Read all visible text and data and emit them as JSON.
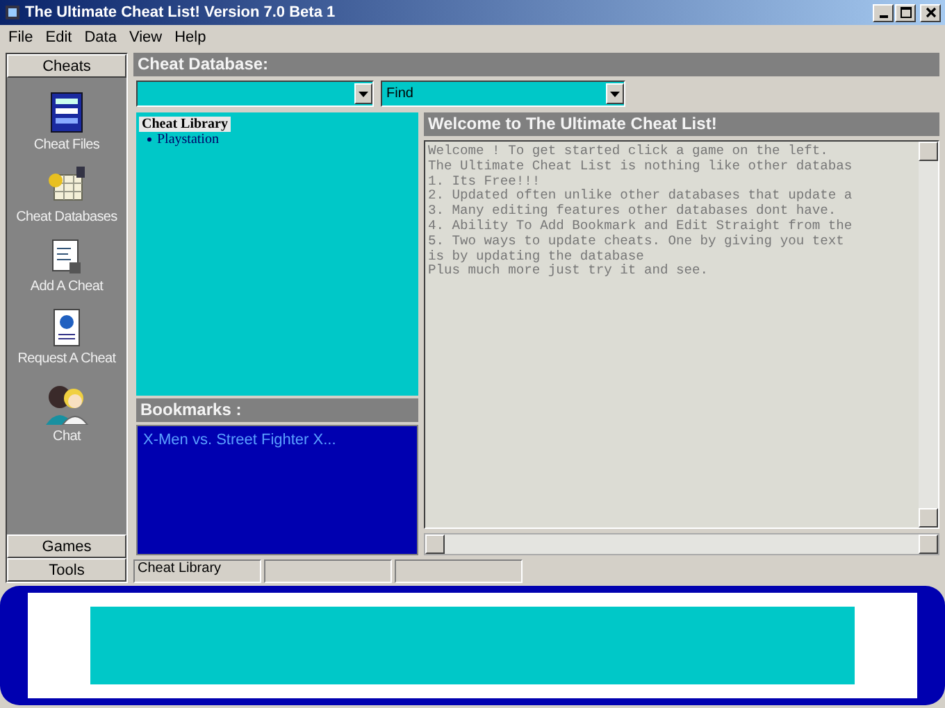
{
  "window": {
    "title": "The Ultimate Cheat List!  Version 7.0 Beta 1"
  },
  "menu": [
    "File",
    "Edit",
    "Data",
    "View",
    "Help"
  ],
  "sidebar": {
    "sections": [
      {
        "label": "Cheats",
        "expanded": true,
        "items": [
          {
            "label": "Cheat Files",
            "kind": "files"
          },
          {
            "label": "Cheat Databases",
            "kind": "databases"
          },
          {
            "label": "Add A Cheat",
            "kind": "add"
          },
          {
            "label": "Request A Cheat",
            "kind": "request"
          },
          {
            "label": "Chat",
            "kind": "chat"
          }
        ]
      },
      {
        "label": "Games",
        "expanded": false
      },
      {
        "label": "Tools",
        "expanded": false
      }
    ]
  },
  "database": {
    "title": "Cheat Database:",
    "find_value": "Find"
  },
  "library": {
    "title": "Cheat Library",
    "tree": [
      {
        "label": "Playstation"
      }
    ]
  },
  "bookmarks": {
    "title": "Bookmarks :",
    "items": [
      "X-Men vs. Street Fighter  X..."
    ]
  },
  "welcome": {
    "title": "Welcome to The Ultimate Cheat List!",
    "lines": [
      "Welcome ! To get started click a game on the left.",
      "The Ultimate Cheat List is nothing like other databas",
      "1. Its Free!!!",
      "2. Updated often unlike other databases that update a",
      "3. Many editing features other databases dont have.",
      "4. Ability To Add Bookmark and Edit Straight from the",
      "5. Two ways to update cheats. One by giving you text",
      "is by updating the database",
      "Plus much more just try it and see."
    ]
  },
  "status_bar": [
    "Cheat Library"
  ]
}
